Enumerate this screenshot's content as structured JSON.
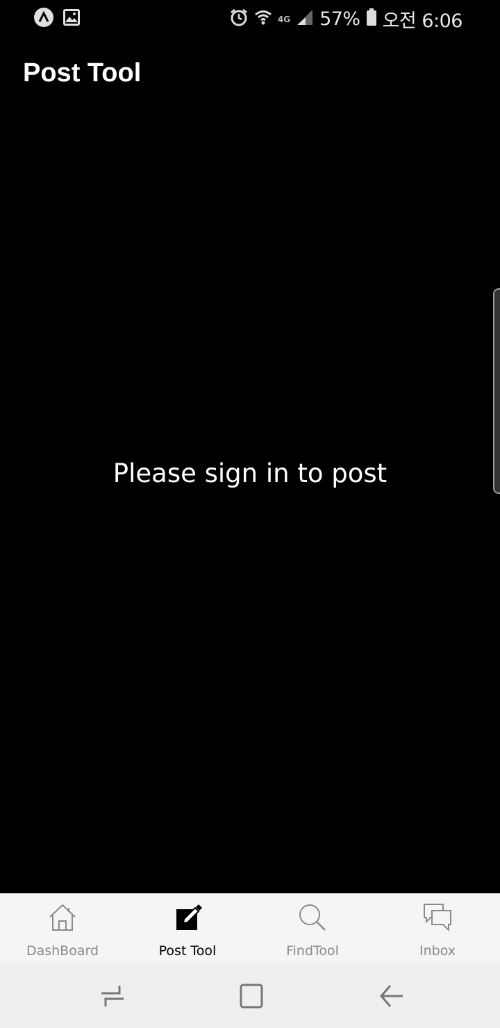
{
  "status_bar": {
    "left_icons": [
      "app-notification-icon",
      "gallery-notification-icon"
    ],
    "right_icons": [
      "alarm-icon",
      "wifi-icon",
      "lte-icon",
      "signal-icon",
      "battery-icon"
    ],
    "network_label": "4G",
    "battery_percent": "57%",
    "time": "오전 6:06"
  },
  "header": {
    "title": "Post Tool"
  },
  "main": {
    "message": "Please sign in to post"
  },
  "tabs": [
    {
      "label": "DashBoard",
      "icon": "home-icon",
      "active": false
    },
    {
      "label": "Post Tool",
      "icon": "edit-icon",
      "active": true
    },
    {
      "label": "FindTool",
      "icon": "search-icon",
      "active": false
    },
    {
      "label": "Inbox",
      "icon": "chat-icon",
      "active": false
    }
  ],
  "nav_bar": {
    "buttons": [
      "recent-apps-icon",
      "home-button-icon",
      "back-icon"
    ]
  },
  "colors": {
    "background": "#000000",
    "tab_bar": "#f5f5f5",
    "nav_bar": "#efefef",
    "inactive_tab": "#8a8a8a",
    "active_tab": "#000000"
  }
}
